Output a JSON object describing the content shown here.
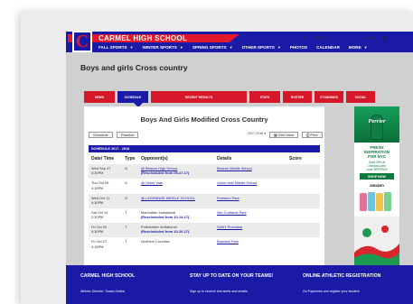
{
  "header": {
    "school_name": "CARMEL HIGH SCHOOL",
    "logo_letter": "C",
    "utility": [
      "Section 1",
      "Sign Up for Alerts",
      "Login"
    ],
    "nav": [
      {
        "label": "FALL SPORTS",
        "caret": true
      },
      {
        "label": "WINTER SPORTS",
        "caret": true
      },
      {
        "label": "SPRING SPORTS",
        "caret": true
      },
      {
        "label": "OTHER SPORTS",
        "caret": true
      },
      {
        "label": "PHOTOS",
        "caret": false
      },
      {
        "label": "CALENDAR",
        "caret": false
      },
      {
        "label": "MORE",
        "caret": true
      }
    ]
  },
  "page_title": "Boys and girls Cross country",
  "tabs": [
    {
      "label": "NEWS",
      "active": false
    },
    {
      "label": "SCHEDULE",
      "active": true
    },
    {
      "label": "RECENT RESULTS",
      "active": false
    },
    {
      "label": "STATS",
      "active": false
    },
    {
      "label": "ROSTER",
      "active": false
    },
    {
      "label": "STANDINGS",
      "active": false
    },
    {
      "label": "SOCIAL",
      "active": false
    }
  ],
  "content": {
    "title": "Boys And Girls Modified Cross Country",
    "buttons": {
      "schedule": "Schedule",
      "practice": "Practice"
    },
    "season": "2017-2018",
    "grid_view": "Grid View",
    "print": "Print",
    "schedule_bar": "SCHEDULE 2017 - 2018",
    "columns": [
      "Date/ Time",
      "Type",
      "Opponent(s)",
      "Details",
      "Score"
    ],
    "rows": [
      {
        "date": "Wed Sep 27",
        "time": "4:30PM",
        "type": "G",
        "opponent": "@ Beacon High School",
        "note": "(Rescheduled from 09-27-17)",
        "details": "Beacon Middle School"
      },
      {
        "date": "Thu Oct 05",
        "time": "4:15PM",
        "type": "G",
        "opponent": "@ Union Vale",
        "note": "",
        "details": "Union Vale Middle School"
      },
      {
        "date": "Wed Oct 11",
        "time": "4:30PM",
        "type": "G",
        "opponent": "@ LAGRANGE MIDDLE SCHOOL",
        "note": "",
        "details": "Freedom Park"
      },
      {
        "date": "Sat Oct 14",
        "time": "2:30PM",
        "type": "T",
        "opponent": "Manhattan Invitational",
        "note": "(Rescheduled from 10-14-17)",
        "details": "Van Cortlandt Park"
      },
      {
        "date": "Fri Oct 20",
        "time": "4:30PM",
        "type": "T",
        "opponent": "Portchester Invitational",
        "note": "(Rescheduled from 10-20-17)",
        "details": "SUNY Purchase"
      },
      {
        "date": "Fri Oct 27",
        "time": "4:15PM",
        "type": "T",
        "opponent": "Northern Counties",
        "note": "",
        "details": "Bowdoin Park"
      }
    ]
  },
  "ad": {
    "brand": "Perrier",
    "headline": [
      "FRESH",
      "INSPIRATION",
      "FOR NYC"
    ],
    "sub": [
      "Save 20% at",
      "checkout with",
      "code SIPPER20"
    ],
    "cta": "SHOP NOW",
    "retailer": "amazon"
  },
  "footer": {
    "col1_head": "CARMEL HIGH SCHOOL",
    "col1_sub": "Athletic Director: Susan Dellea",
    "col2_head": "STAY UP TO DATE ON YOUR TEAMS!",
    "col2_sub": "Sign up to receive text alerts and emails.",
    "col3_head": "ONLINE ATHLETIC REGISTRATION",
    "col3_sub": "Go Paperless and register your student"
  },
  "colors": {
    "brand_blue": "#1b1aa6",
    "brand_red": "#e3182d",
    "link": "#1b1aa6"
  },
  "icons": [
    "search-icon",
    "user-icon",
    "grid-icon",
    "print-icon",
    "chevron-down-icon"
  ]
}
